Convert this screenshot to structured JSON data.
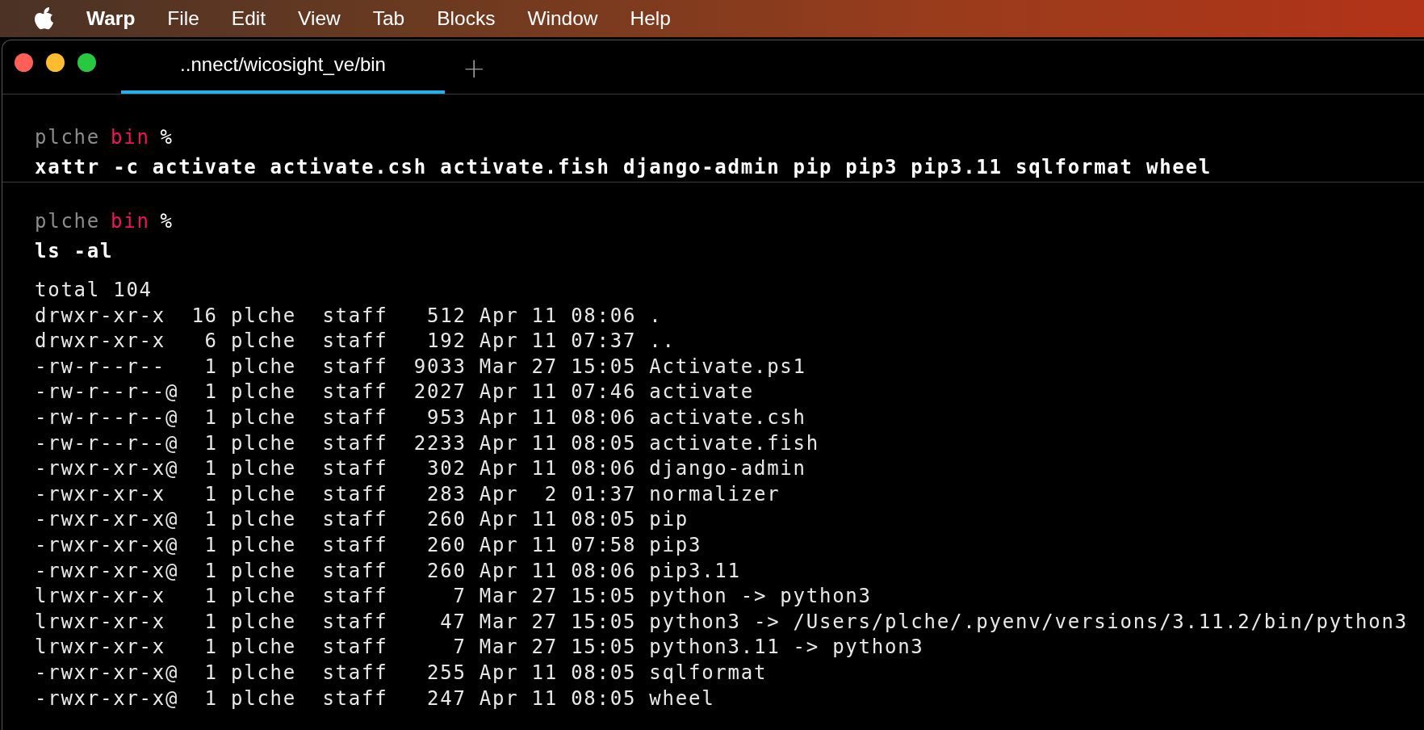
{
  "menu_bar": {
    "app_name": "Warp",
    "items": [
      "File",
      "Edit",
      "View",
      "Tab",
      "Blocks",
      "Window",
      "Help"
    ]
  },
  "window": {
    "tabs": [
      {
        "title": "..nnect/wicosight_ve/bin",
        "selected": true
      }
    ],
    "new_tab": "+"
  },
  "blocks": [
    {
      "prompt": {
        "user": "plche",
        "directory": "bin",
        "symbol": "%"
      },
      "command": "xattr -c activate activate.csh activate.fish django-admin pip pip3 pip3.11 sqlformat wheel"
    },
    {
      "prompt": {
        "user": "plche",
        "directory": "bin",
        "symbol": "%"
      },
      "command": "ls -al",
      "output": [
        "total 104",
        "drwxr-xr-x  16 plche  staff   512 Apr 11 08:06 .",
        "drwxr-xr-x   6 plche  staff   192 Apr 11 07:37 ..",
        "-rw-r--r--   1 plche  staff  9033 Mar 27 15:05 Activate.ps1",
        "-rw-r--r--@  1 plche  staff  2027 Apr 11 07:46 activate",
        "-rw-r--r--@  1 plche  staff   953 Apr 11 08:06 activate.csh",
        "-rw-r--r--@  1 plche  staff  2233 Apr 11 08:05 activate.fish",
        "-rwxr-xr-x@  1 plche  staff   302 Apr 11 08:06 django-admin",
        "-rwxr-xr-x   1 plche  staff   283 Apr  2 01:37 normalizer",
        "-rwxr-xr-x@  1 plche  staff   260 Apr 11 08:05 pip",
        "-rwxr-xr-x@  1 plche  staff   260 Apr 11 07:58 pip3",
        "-rwxr-xr-x@  1 plche  staff   260 Apr 11 08:06 pip3.11",
        "lrwxr-xr-x   1 plche  staff     7 Mar 27 15:05 python -> python3",
        "lrwxr-xr-x   1 plche  staff    47 Mar 27 15:05 python3 -> /Users/plche/.pyenv/versions/3.11.2/bin/python3",
        "lrwxr-xr-x   1 plche  staff     7 Mar 27 15:05 python3.11 -> python3",
        "-rwxr-xr-x@  1 plche  staff   255 Apr 11 08:05 sqlformat",
        "-rwxr-xr-x@  1 plche  staff   247 Apr 11 08:05 wheel"
      ]
    }
  ]
}
